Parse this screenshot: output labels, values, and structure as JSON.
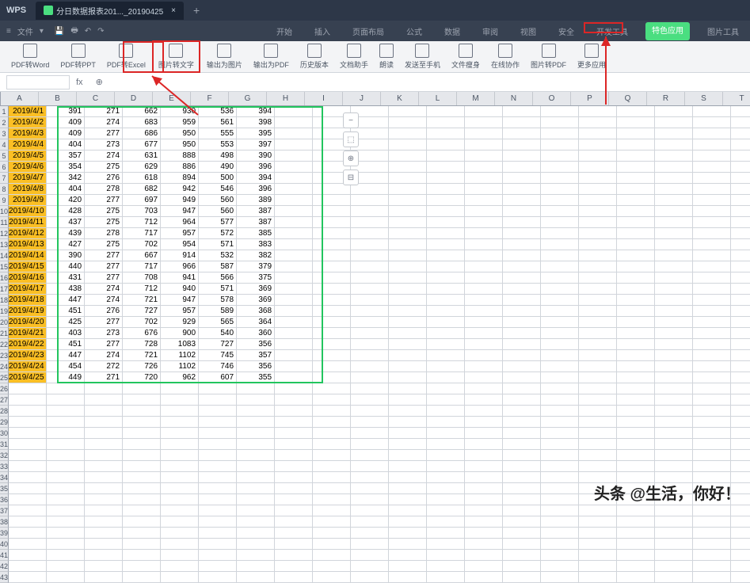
{
  "titlebar": {
    "app": "WPS",
    "tab": "分日数据报表201..._20190425",
    "plus": "+"
  },
  "menubar": {
    "file": "文件",
    "tabs": [
      "开始",
      "插入",
      "页面布局",
      "公式",
      "数据",
      "审阅",
      "视图",
      "安全",
      "开发工具",
      "特色应用",
      "图片工具"
    ]
  },
  "toolbar": {
    "items": [
      "PDF转Word",
      "PDF转PPT",
      "PDF转Excel",
      "图片转文字",
      "输出为图片",
      "输出为PDF",
      "历史版本",
      "文档助手",
      "朗读",
      "发送至手机",
      "文件瘦身",
      "在线协作",
      "图片转PDF",
      "更多应用"
    ]
  },
  "columns": [
    "A",
    "B",
    "C",
    "D",
    "E",
    "F",
    "G",
    "H",
    "I",
    "J",
    "K",
    "L",
    "M",
    "N",
    "O",
    "P",
    "Q",
    "R",
    "S",
    "T"
  ],
  "data_rows": [
    {
      "date": "2019/4/1",
      "b": 391,
      "c": 271,
      "d": 662,
      "e": 930,
      "f": 536,
      "g": 394
    },
    {
      "date": "2019/4/2",
      "b": 409,
      "c": 274,
      "d": 683,
      "e": 959,
      "f": 561,
      "g": 398
    },
    {
      "date": "2019/4/3",
      "b": 409,
      "c": 277,
      "d": 686,
      "e": 950,
      "f": 555,
      "g": 395
    },
    {
      "date": "2019/4/4",
      "b": 404,
      "c": 273,
      "d": 677,
      "e": 950,
      "f": 553,
      "g": 397
    },
    {
      "date": "2019/4/5",
      "b": 357,
      "c": 274,
      "d": 631,
      "e": 888,
      "f": 498,
      "g": 390
    },
    {
      "date": "2019/4/6",
      "b": 354,
      "c": 275,
      "d": 629,
      "e": 886,
      "f": 490,
      "g": 396
    },
    {
      "date": "2019/4/7",
      "b": 342,
      "c": 276,
      "d": 618,
      "e": 894,
      "f": 500,
      "g": 394
    },
    {
      "date": "2019/4/8",
      "b": 404,
      "c": 278,
      "d": 682,
      "e": 942,
      "f": 546,
      "g": 396
    },
    {
      "date": "2019/4/9",
      "b": 420,
      "c": 277,
      "d": 697,
      "e": 949,
      "f": 560,
      "g": 389
    },
    {
      "date": "2019/4/10",
      "b": 428,
      "c": 275,
      "d": 703,
      "e": 947,
      "f": 560,
      "g": 387
    },
    {
      "date": "2019/4/11",
      "b": 437,
      "c": 275,
      "d": 712,
      "e": 964,
      "f": 577,
      "g": 387
    },
    {
      "date": "2019/4/12",
      "b": 439,
      "c": 278,
      "d": 717,
      "e": 957,
      "f": 572,
      "g": 385
    },
    {
      "date": "2019/4/13",
      "b": 427,
      "c": 275,
      "d": 702,
      "e": 954,
      "f": 571,
      "g": 383
    },
    {
      "date": "2019/4/14",
      "b": 390,
      "c": 277,
      "d": 667,
      "e": 914,
      "f": 532,
      "g": 382
    },
    {
      "date": "2019/4/15",
      "b": 440,
      "c": 277,
      "d": 717,
      "e": 966,
      "f": 587,
      "g": 379
    },
    {
      "date": "2019/4/16",
      "b": 431,
      "c": 277,
      "d": 708,
      "e": 941,
      "f": 566,
      "g": 375
    },
    {
      "date": "2019/4/17",
      "b": 438,
      "c": 274,
      "d": 712,
      "e": 940,
      "f": 571,
      "g": 369
    },
    {
      "date": "2019/4/18",
      "b": 447,
      "c": 274,
      "d": 721,
      "e": 947,
      "f": 578,
      "g": 369
    },
    {
      "date": "2019/4/19",
      "b": 451,
      "c": 276,
      "d": 727,
      "e": 957,
      "f": 589,
      "g": 368
    },
    {
      "date": "2019/4/20",
      "b": 425,
      "c": 277,
      "d": 702,
      "e": 929,
      "f": 565,
      "g": 364
    },
    {
      "date": "2019/4/21",
      "b": 403,
      "c": 273,
      "d": 676,
      "e": 900,
      "f": 540,
      "g": 360
    },
    {
      "date": "2019/4/22",
      "b": 451,
      "c": 277,
      "d": 728,
      "e": 1083,
      "f": 727,
      "g": 356
    },
    {
      "date": "2019/4/23",
      "b": 447,
      "c": 274,
      "d": 721,
      "e": 1102,
      "f": 745,
      "g": 357
    },
    {
      "date": "2019/4/24",
      "b": 454,
      "c": 272,
      "d": 726,
      "e": 1102,
      "f": 746,
      "g": 356
    },
    {
      "date": "2019/4/25",
      "b": 449,
      "c": 271,
      "d": 720,
      "e": 962,
      "f": 607,
      "g": 355
    }
  ],
  "total_rows": 43,
  "watermark": "头条 @生活，你好！",
  "side_tools": [
    "−",
    "⬚",
    "⊕",
    "⊟"
  ]
}
